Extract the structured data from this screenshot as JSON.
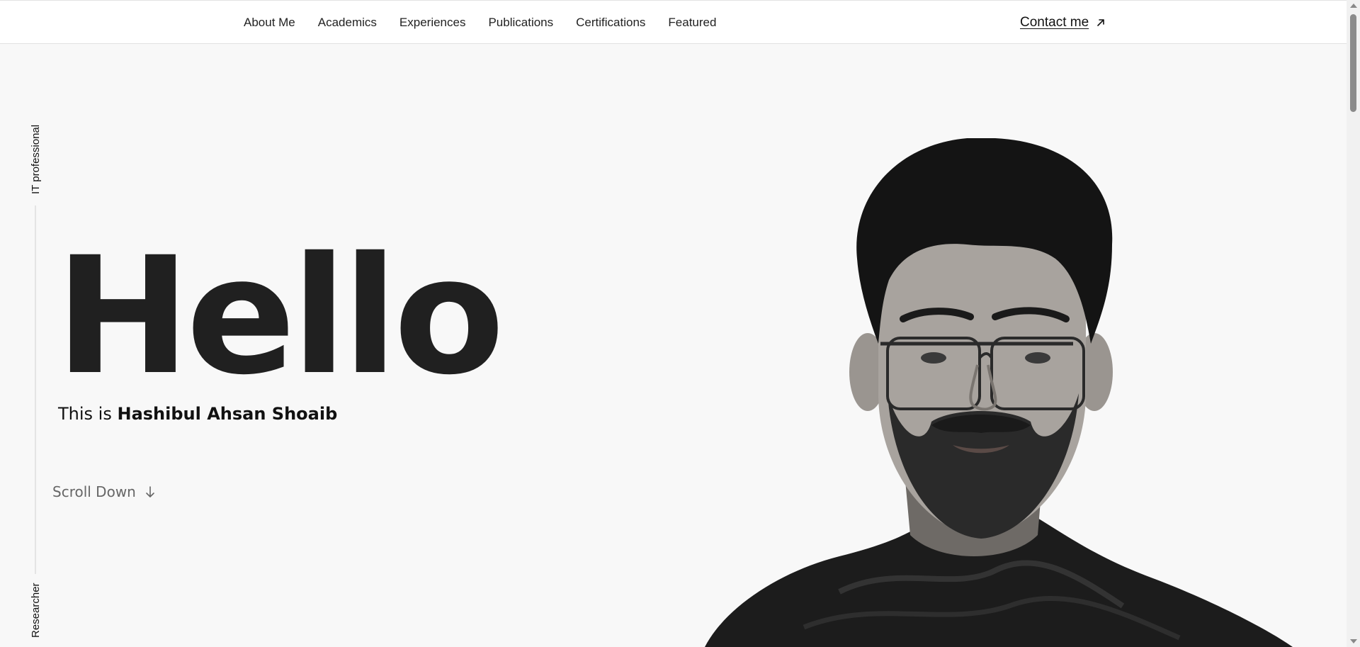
{
  "nav": {
    "items": [
      {
        "label": "About Me"
      },
      {
        "label": "Academics"
      },
      {
        "label": "Experiences"
      },
      {
        "label": "Publications"
      },
      {
        "label": "Certifications"
      },
      {
        "label": "Featured"
      }
    ],
    "contact_label": "Contact me",
    "contact_icon": "arrow-up-right-icon"
  },
  "side": {
    "top_text": "IT professional",
    "bottom_text": "Researcher"
  },
  "hero": {
    "greeting": "Hello",
    "intro_prefix": "This is ",
    "name": "Hashibul Ahsan Shoaib",
    "scroll_label": "Scroll Down",
    "scroll_icon": "arrow-down-icon"
  },
  "colors": {
    "background": "#f8f8f8",
    "text": "#202020",
    "muted": "#666666"
  }
}
